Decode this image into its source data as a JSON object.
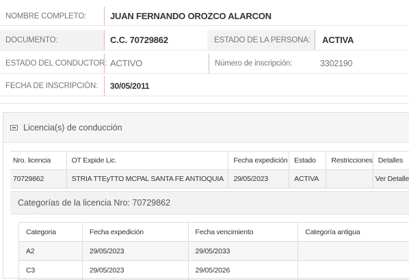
{
  "person": {
    "nombre_label": "NOMBRE COMPLETO:",
    "nombre_value": "JUAN FERNANDO OROZCO ALARCON",
    "documento_label": "DOCUMENTO:",
    "documento_value": "C.C. 70729862",
    "estado_persona_label": "ESTADO DE LA PERSONA:",
    "estado_persona_value": "ACTIVA",
    "estado_conductor_label": "ESTADO DEL CONDUCTOR:",
    "estado_conductor_value": "ACTIVO",
    "numero_inscripcion_label": "Número de inscripción:",
    "numero_inscripcion_value": "3302190",
    "fecha_inscripcion_label": "FECHA DE INSCRIPCIÓN:",
    "fecha_inscripcion_value": "30/05/2011"
  },
  "licenses_panel": {
    "title": "Licencia(s) de conducción",
    "icon": "id-card-icon",
    "headers": [
      "Nro. licencia",
      "OT Expide Lic.",
      "Fecha expedición",
      "Estado",
      "Restricciones",
      "Detalles"
    ],
    "rows": [
      {
        "nro": "70729862",
        "ot": "STRIA TTEyTTO MCPAL SANTA FE ANTIOQUIA",
        "fecha": "29/05/2023",
        "estado": "ACTIVA",
        "restricciones": "",
        "detalles": "Ver Detalle"
      }
    ]
  },
  "categories": {
    "title": "Categorías de la licencia Nro: 70729862",
    "headers": [
      "Categoria",
      "Fecha expedición",
      "Fecha vencimiento",
      "Categoría antigua"
    ],
    "rows": [
      {
        "categoria": "A2",
        "expedicion": "29/05/2023",
        "vencimiento": "29/05/2033",
        "antigua": ""
      },
      {
        "categoria": "C3",
        "expedicion": "29/05/2023",
        "vencimiento": "29/05/2026",
        "antigua": ""
      }
    ]
  }
}
